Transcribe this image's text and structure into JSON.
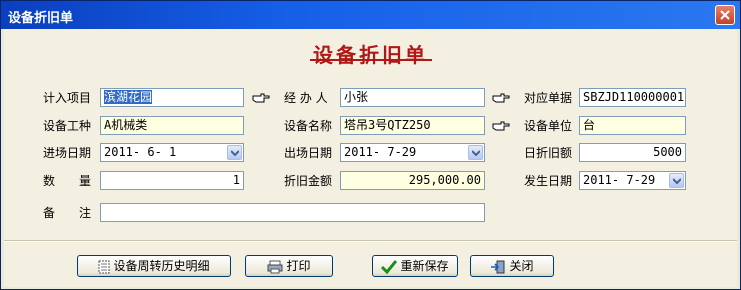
{
  "window": {
    "title": "设备折旧单"
  },
  "form": {
    "heading": "设备折旧单",
    "fields": {
      "project": {
        "label": "计入项目",
        "value": "滨湖花园"
      },
      "handler": {
        "label": "经 办 人",
        "value": "小张"
      },
      "voucher": {
        "label": "对应单据",
        "value": "SBZJD110000001"
      },
      "work_type": {
        "label": "设备工种",
        "value": "A机械类"
      },
      "equipment_name": {
        "label": "设备名称",
        "value": "塔吊3号QTZ250"
      },
      "equipment_unit": {
        "label": "设备单位",
        "value": "台"
      },
      "entry_date": {
        "label": "进场日期",
        "value": "2011- 6- 1"
      },
      "exit_date": {
        "label": "出场日期",
        "value": "2011- 7-29"
      },
      "daily_depreciation": {
        "label": "日折旧额",
        "value": "5000"
      },
      "quantity": {
        "label": "数　　量",
        "value": "1"
      },
      "depreciation_amount": {
        "label": "折旧金额",
        "value": "295,000.00"
      },
      "occur_date": {
        "label": "发生日期",
        "value": "2011- 7-29"
      },
      "remark": {
        "label": "备　　注",
        "value": ""
      }
    }
  },
  "buttons": {
    "history": "设备周转历史明细",
    "print": "打印",
    "resave": "重新保存",
    "close": "关闭"
  },
  "icons": {
    "lookup": "pointing-hand-icon",
    "dropdown": "chevron-down-icon"
  },
  "colors": {
    "heading": "#b01818",
    "titlebar": "#0a3fbf",
    "highlight_field": "#ffffe1"
  }
}
